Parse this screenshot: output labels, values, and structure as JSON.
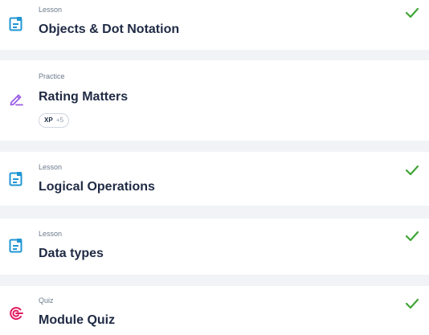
{
  "items": [
    {
      "type": "Lesson",
      "title": "Objects & Dot Notation",
      "icon": "lesson-document-icon",
      "completed": true
    },
    {
      "type": "Practice",
      "title": "Rating Matters",
      "icon": "practice-pencil-icon",
      "completed": false,
      "xp": {
        "label": "XP",
        "value": "+5"
      }
    },
    {
      "type": "Lesson",
      "title": "Logical Operations",
      "icon": "lesson-document-icon",
      "completed": true
    },
    {
      "type": "Lesson",
      "title": "Data types",
      "icon": "lesson-document-icon",
      "completed": true
    },
    {
      "type": "Quiz",
      "title": "Module Quiz",
      "icon": "quiz-target-icon",
      "completed": true
    }
  ],
  "colors": {
    "lesson_icon": "#2196d3",
    "practice_icon": "#9b5de5",
    "quiz_icon": "#e0185e",
    "check": "#3fa535",
    "title": "#1f2a44",
    "subtitle": "#6b7a8b",
    "background": "#f1f3f6"
  }
}
